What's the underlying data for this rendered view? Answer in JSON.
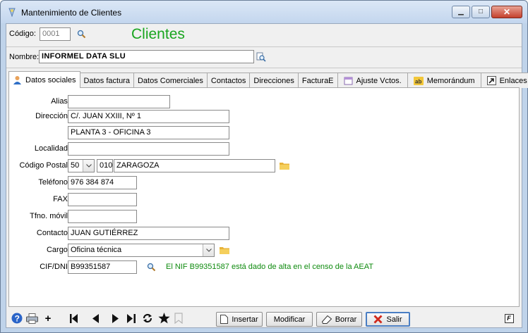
{
  "window": {
    "title": "Mantenimiento de Clientes"
  },
  "header": {
    "codigo_label": "Código:",
    "codigo_value": "0001",
    "heading": "Clientes",
    "nombre_label": "Nombre:",
    "nombre_value": "INFORMEL DATA SLU"
  },
  "tabs": [
    {
      "label": "Datos sociales",
      "icon": "person-icon",
      "active": true
    },
    {
      "label": "Datos factura"
    },
    {
      "label": "Datos Comerciales"
    },
    {
      "label": "Contactos"
    },
    {
      "label": "Direcciones"
    },
    {
      "label": "FacturaE"
    },
    {
      "label": "Ajuste Vctos.",
      "icon": "calendar-icon"
    },
    {
      "label": "Memorándum",
      "icon": "ab-icon"
    },
    {
      "label": "Enlaces",
      "icon": "shortcut-icon"
    }
  ],
  "form": {
    "alias_label": "Alias:",
    "alias_value": "",
    "direccion_label": "Dirección:",
    "direccion_1": "C/. JUAN XXIII, Nº 1",
    "direccion_2": "PLANTA 3 - OFICINA 3",
    "localidad_label": "Localidad:",
    "localidad_value": "",
    "cp_label": "Código Postal:",
    "cp_province": "50",
    "cp_number": "010",
    "cp_city": "ZARAGOZA",
    "telefono_label": "Teléfono:",
    "telefono_value": "976 384 874",
    "fax_label": "FAX:",
    "fax_value": "",
    "movil_label": "Tfno. móvil:",
    "movil_value": "",
    "contacto_label": "Contacto:",
    "contacto_value": "JUAN GUTIÉRREZ",
    "cargo_label": "Cargo:",
    "cargo_value": "Oficina técnica",
    "cif_label": "CIF/DNI:",
    "cif_value": "B99351587",
    "aeat_message": "El NIF B99351587 está dado de alta en el censo de la AEAT"
  },
  "toolbar": {
    "plus": "+",
    "insertar": "Insertar",
    "modificar": "Modificar",
    "borrar": "Borrar",
    "salir": "Salir",
    "f_badge": "F"
  },
  "colors": {
    "heading": "#19a51f",
    "aeat_message": "#0f8b0f",
    "folder": "#e8b33a",
    "close_button": "#c4402c"
  }
}
